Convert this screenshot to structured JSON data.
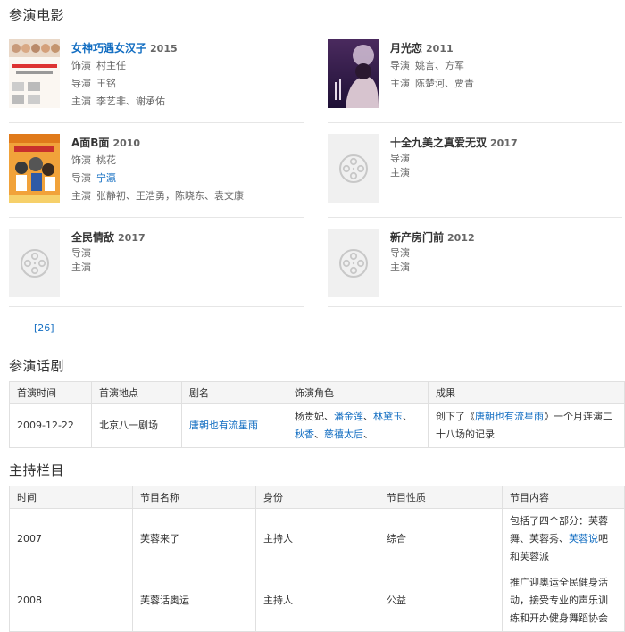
{
  "sections": {
    "films": "参演电影",
    "dramas": "参演话剧",
    "hosting": "主持栏目"
  },
  "movies": [
    {
      "title": "女神巧遇女汉子",
      "year": "2015",
      "title_link": true,
      "rows": [
        {
          "k": "饰演",
          "v": "村主任"
        },
        {
          "k": "导演",
          "v": "王铭"
        },
        {
          "k": "主演",
          "v": "李艺非、谢承佑"
        }
      ]
    },
    {
      "title": "月光恋",
      "year": "2011",
      "title_link": false,
      "rows": [
        {
          "k": "导演",
          "v": "姚言、方军"
        },
        {
          "k": "主演",
          "v": "陈楚河、贾青"
        }
      ]
    },
    {
      "title": "A面B面",
      "year": "2010",
      "title_link": false,
      "rows": [
        {
          "k": "饰演",
          "v": "桃花"
        },
        {
          "k": "导演",
          "v": "宁瀛",
          "link": true
        },
        {
          "k": "主演",
          "v": "张静初、王浩勇，陈晓东、袁文康"
        }
      ]
    },
    {
      "title": "十全九美之真爱无双",
      "year": "2017",
      "title_link": false,
      "rows": [
        {
          "k": "导演",
          "v": ""
        },
        {
          "k": "主演",
          "v": ""
        }
      ]
    },
    {
      "title": "全民情敌",
      "year": "2017",
      "title_link": false,
      "rows": [
        {
          "k": "导演",
          "v": ""
        },
        {
          "k": "主演",
          "v": ""
        }
      ]
    },
    {
      "title": "新产房门前",
      "year": "2012",
      "title_link": false,
      "rows": [
        {
          "k": "导演",
          "v": ""
        },
        {
          "k": "主演",
          "v": ""
        }
      ]
    }
  ],
  "pager": "[26]",
  "drama_table": {
    "headers": [
      "首演时间",
      "首演地点",
      "剧名",
      "饰演角色",
      "成果"
    ],
    "row": {
      "date": "2009-12-22",
      "place": "北京八一剧场",
      "name": "唐朝也有流星雨",
      "roles_plain": "杨贵妃、",
      "roles_links": [
        "潘金莲",
        "林黛玉",
        "秋香",
        "慈禧太后"
      ],
      "result_pre": "创下了《",
      "result_link": "唐朝也有流星雨",
      "result_post": "》一个月连演二十八场的记录"
    }
  },
  "host_table": {
    "headers": [
      "时间",
      "节目名称",
      "身份",
      "节目性质",
      "节目内容"
    ],
    "rows": [
      {
        "time": "2007",
        "name": "芙蓉来了",
        "role": "主持人",
        "type": "综合",
        "content_pre": "包括了四个部分：芙蓉舞、芙蓉秀、",
        "content_link": "芙蓉说",
        "content_post": "吧和芙蓉派"
      },
      {
        "time": "2008",
        "name": "芙蓉话奥运",
        "role": "主持人",
        "type": "公益",
        "content_pre": "推广迎奥运全民健身活动，接受专业的声乐训练和开办健身舞蹈协会",
        "content_link": "",
        "content_post": ""
      }
    ]
  },
  "colors": {
    "link": "#136ec2",
    "border": "#e0e0e0",
    "header_bg": "#f5f5f5",
    "placeholder": "#f0f0f0"
  },
  "icons": {
    "placeholder": "film-reel-icon"
  }
}
